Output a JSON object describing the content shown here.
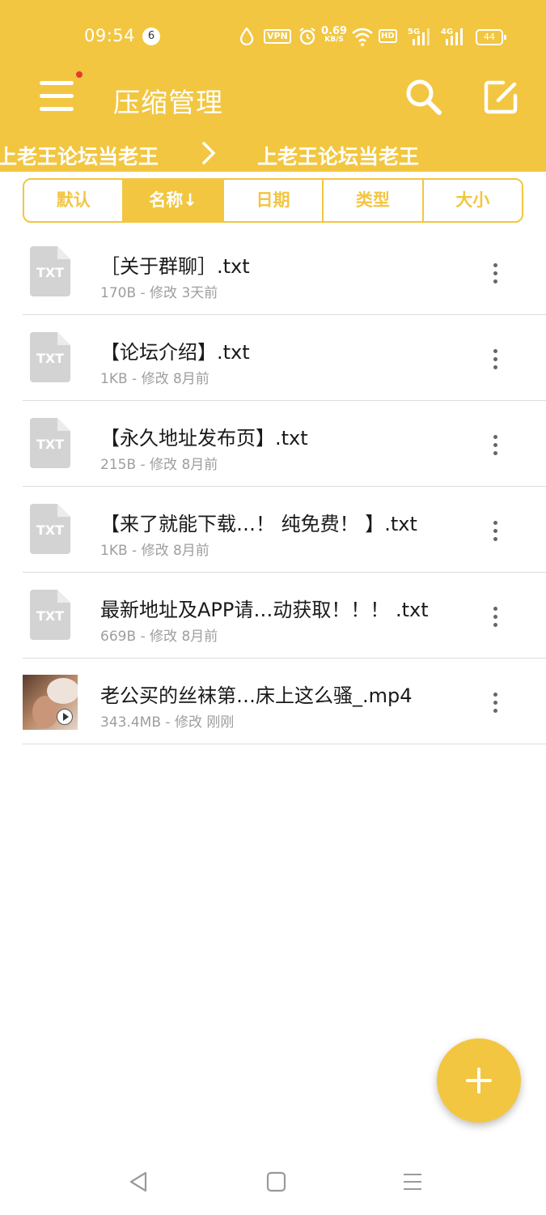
{
  "status_bar": {
    "time": "09:54",
    "notification_count": "6",
    "vpn_label": "VPN",
    "net_speed": "0.69",
    "net_speed_unit": "KB/S",
    "hd_label": "HD",
    "sim1_label": "5G",
    "sim2_label": "4G",
    "battery": "44"
  },
  "toolbar": {
    "title": "压缩管理",
    "menu_icon": "hamburger-menu-icon",
    "search_icon": "search-icon",
    "edit_icon": "edit-icon",
    "accent_color": "#f2c641",
    "badge_color": "#e53935"
  },
  "breadcrumb": {
    "items": [
      "上老王论坛当老王",
      "上老王论坛当老王"
    ],
    "separator_icon": "chevron-right-icon"
  },
  "sort_tabs": [
    {
      "label": "默认",
      "active": false
    },
    {
      "label": "名称↓",
      "active": true
    },
    {
      "label": "日期",
      "active": false
    },
    {
      "label": "类型",
      "active": false
    },
    {
      "label": "大小",
      "active": false
    }
  ],
  "files": [
    {
      "name": "［关于群聊］.txt",
      "meta": "170B - 修改 3天前",
      "icon": "txt-file-icon",
      "icon_text": "TXT"
    },
    {
      "name": "【论坛介绍】.txt",
      "meta": "1KB - 修改 8月前",
      "icon": "txt-file-icon",
      "icon_text": "TXT"
    },
    {
      "name": "【永久地址发布页】.txt",
      "meta": "215B - 修改 8月前",
      "icon": "txt-file-icon",
      "icon_text": "TXT"
    },
    {
      "name": "【来了就能下载…！ 纯免费！ 】.txt",
      "meta": "1KB - 修改 8月前",
      "icon": "txt-file-icon",
      "icon_text": "TXT"
    },
    {
      "name": "最新地址及APP请…动获取！！！ .txt",
      "meta": "669B - 修改 8月前",
      "icon": "txt-file-icon",
      "icon_text": "TXT"
    },
    {
      "name": "老公买的丝袜第…床上这么骚_.mp4",
      "meta": "343.4MB - 修改 刚刚",
      "icon": "video-thumbnail",
      "icon_text": ""
    }
  ],
  "fab": {
    "icon": "plus-icon"
  },
  "nav_bar": {
    "back_icon": "back-triangle-icon",
    "home_icon": "home-square-icon",
    "recents_icon": "recents-lines-icon"
  }
}
